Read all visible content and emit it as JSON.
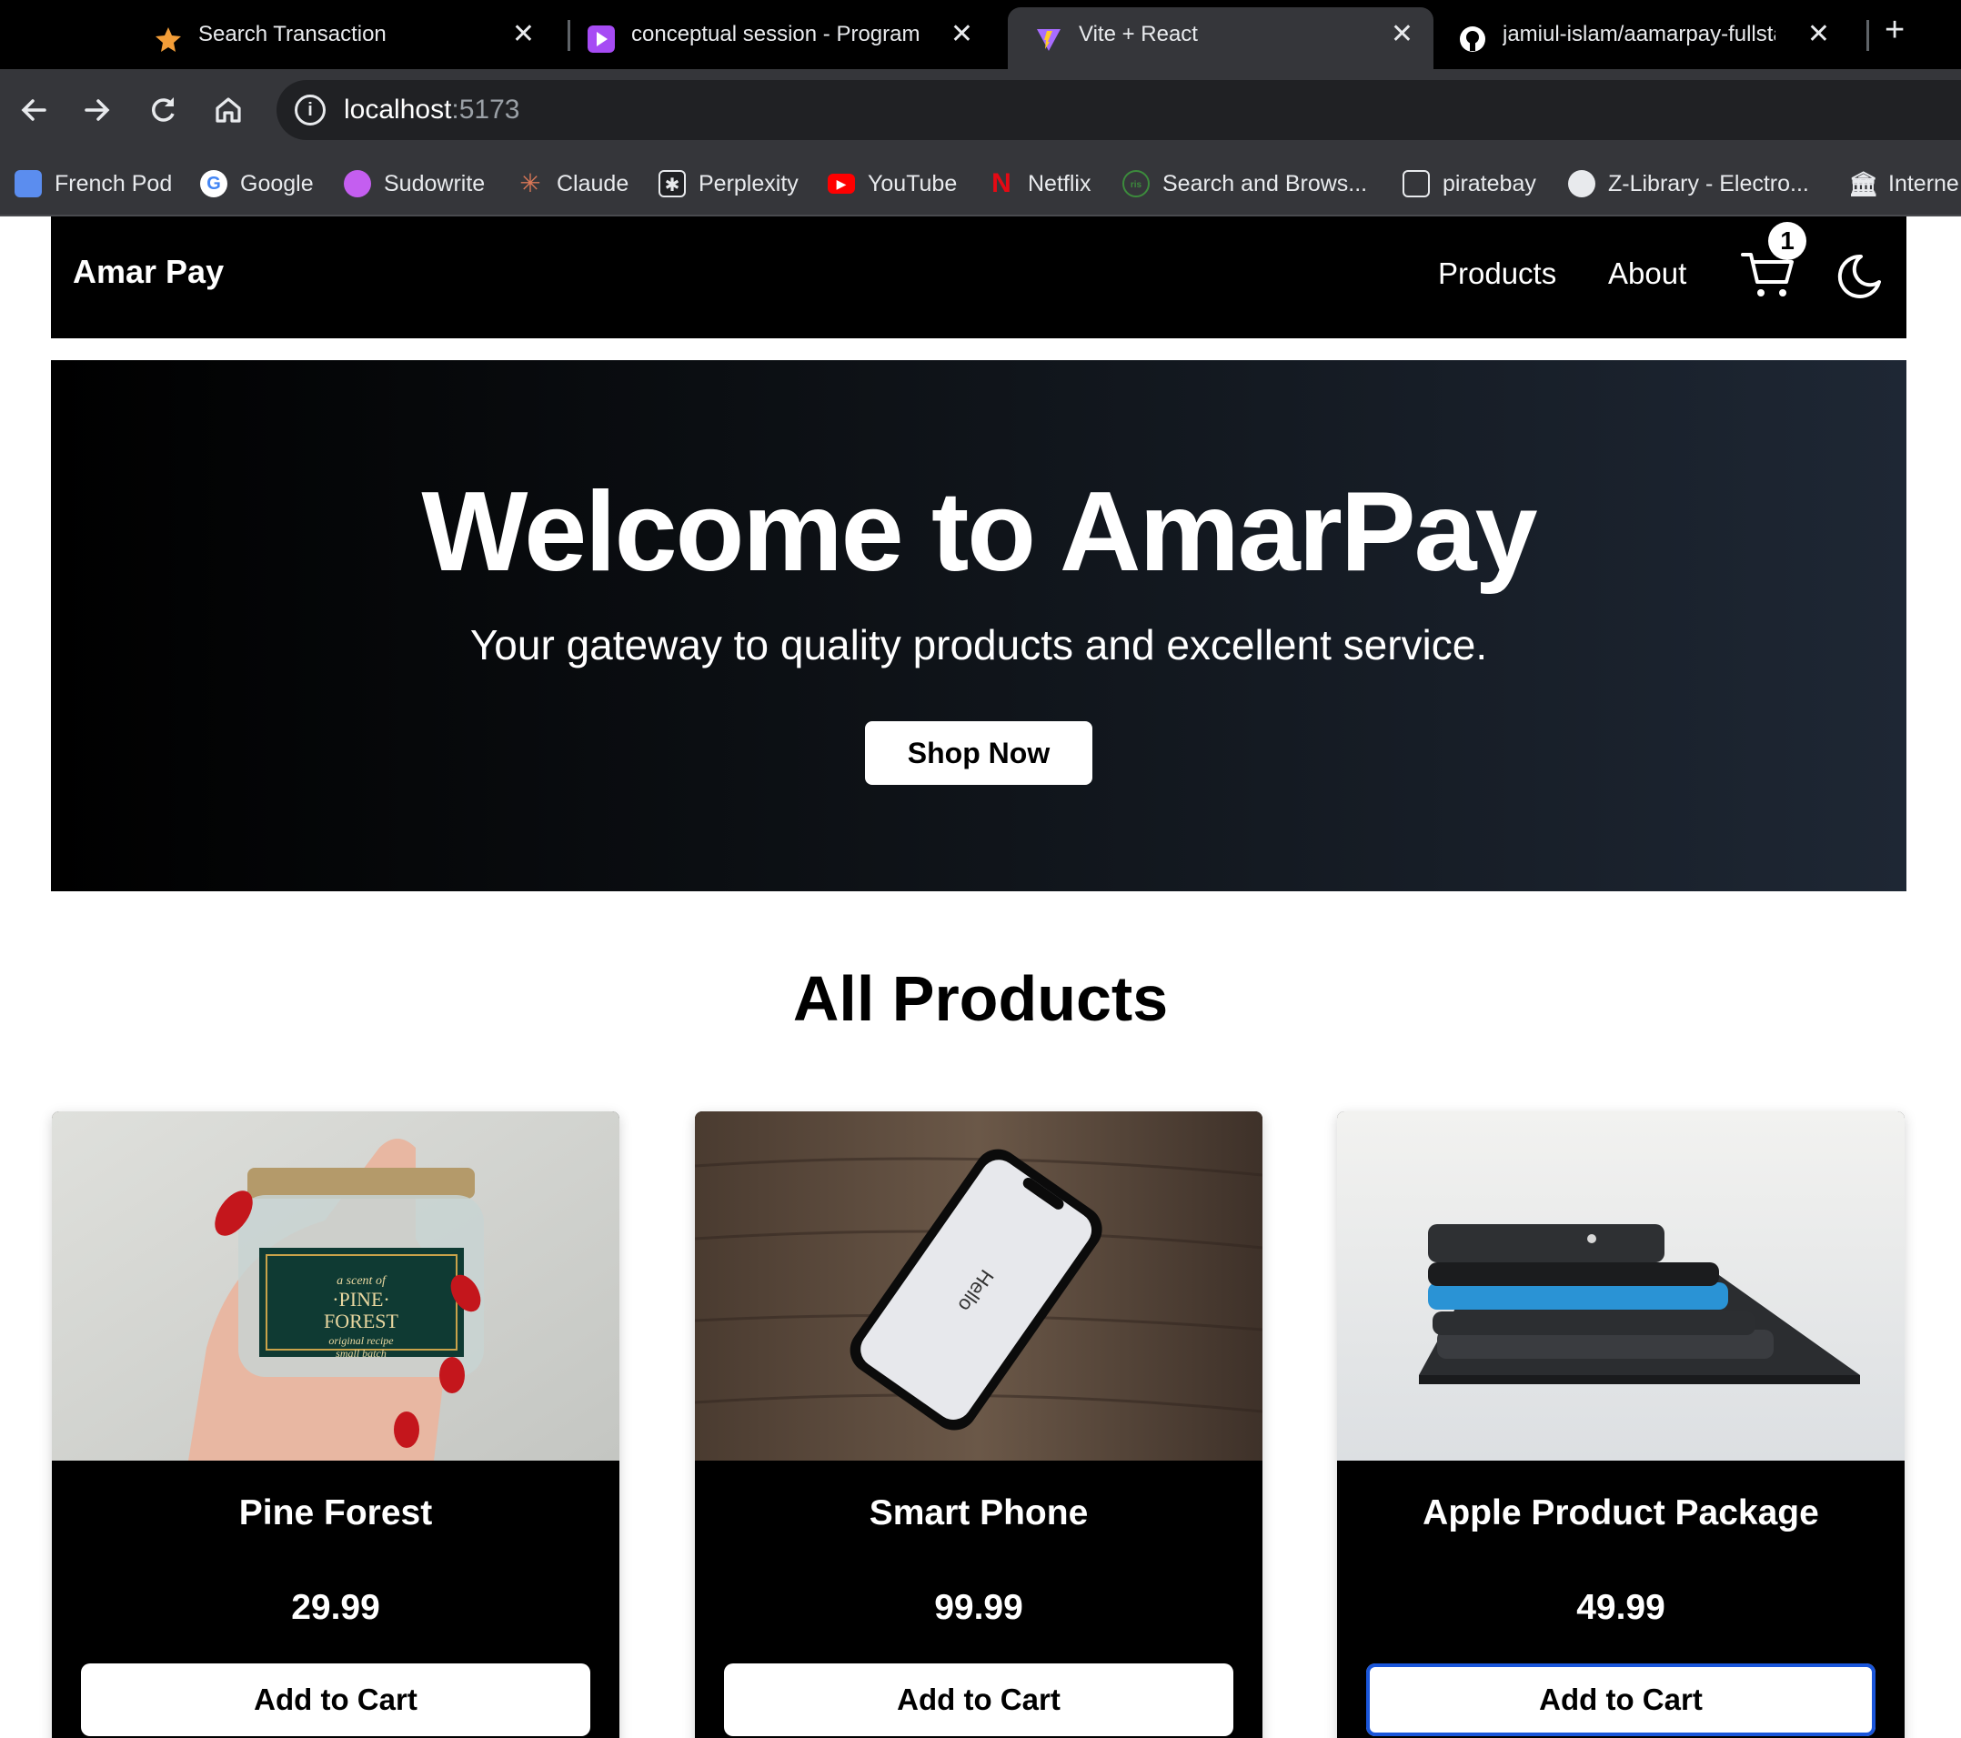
{
  "browser": {
    "tabs": [
      {
        "title": "Search Transaction",
        "icon": "star-favicon-icon",
        "active": false
      },
      {
        "title": "conceptual session - Program",
        "icon": "play-favicon-icon",
        "active": false
      },
      {
        "title": "Vite + React",
        "icon": "vite-favicon-icon",
        "active": true
      },
      {
        "title": "jamiul-islam/aamarpay-fullsta",
        "icon": "github-favicon-icon",
        "active": false
      }
    ],
    "close_glyph": "✕",
    "new_tab_glyph": "+",
    "address": {
      "host": "localhost",
      "port": ":5173"
    },
    "bookmarks": [
      {
        "label": "French Pod",
        "icon": "french-pod-icon"
      },
      {
        "label": "Google",
        "icon": "google-icon"
      },
      {
        "label": "Sudowrite",
        "icon": "sudowrite-icon"
      },
      {
        "label": "Claude",
        "icon": "claude-icon"
      },
      {
        "label": "Perplexity",
        "icon": "perplexity-icon"
      },
      {
        "label": "YouTube",
        "icon": "youtube-icon"
      },
      {
        "label": "Netflix",
        "icon": "netflix-icon"
      },
      {
        "label": "Search and Brows...",
        "icon": "search-browse-icon"
      },
      {
        "label": "piratebay",
        "icon": "piratebay-icon"
      },
      {
        "label": "Z-Library - Electro...",
        "icon": "zlibrary-icon"
      },
      {
        "label": "Interne",
        "icon": "internet-archive-icon"
      }
    ]
  },
  "site": {
    "brand": "Amar Pay",
    "nav": {
      "products": "Products",
      "about": "About"
    },
    "cart_count": "1",
    "hero": {
      "title": "Welcome to AmarPay",
      "subtitle": "Your gateway to quality products and excellent service.",
      "cta": "Shop Now"
    },
    "section_title": "All Products",
    "products": [
      {
        "name": "Pine Forest",
        "price": "29.99",
        "button": "Add to Cart",
        "jar_label": [
          "a scent of",
          "·PINE·",
          "FOREST",
          "original recipe",
          "small batch"
        ]
      },
      {
        "name": "Smart Phone",
        "price": "99.99",
        "button": "Add to Cart",
        "screen_text": "Hello"
      },
      {
        "name": "Apple Product Package",
        "price": "49.99",
        "button": "Add to Cart"
      }
    ]
  },
  "colors": {
    "nav_bg": "#000000",
    "hero_start": "#000000",
    "hero_end": "#1e2734",
    "focus_ring": "#1a56db"
  }
}
